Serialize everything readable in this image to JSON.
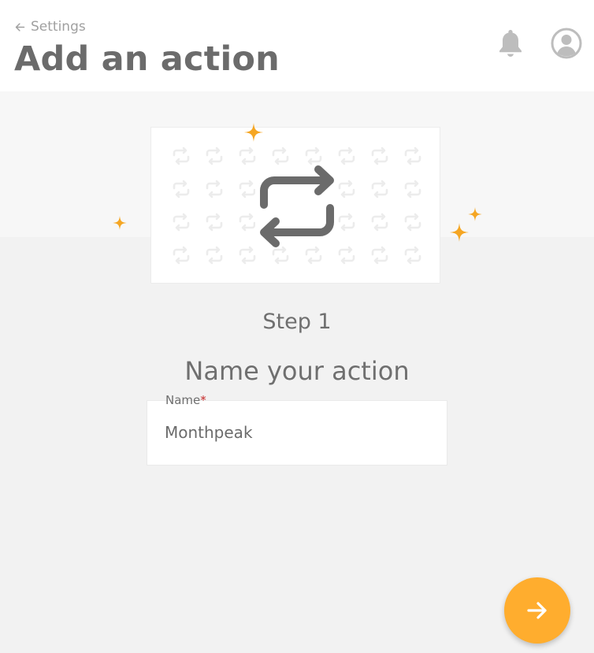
{
  "header": {
    "back_label": "Settings",
    "title": "Add an action"
  },
  "icons": {
    "back": "arrow-left-icon",
    "notifications": "bell-icon",
    "account": "user-avatar-icon",
    "hero": "repeat-icon",
    "next": "arrow-right-icon"
  },
  "step": {
    "label": "Step 1",
    "heading": "Name your action"
  },
  "form": {
    "name_label": "Name",
    "required_mark": "*",
    "name_value": "Monthpeak"
  },
  "colors": {
    "accent": "#ffad2e",
    "sparkle": "#f5a623",
    "required": "#c62828",
    "title": "#6b6b6b"
  }
}
